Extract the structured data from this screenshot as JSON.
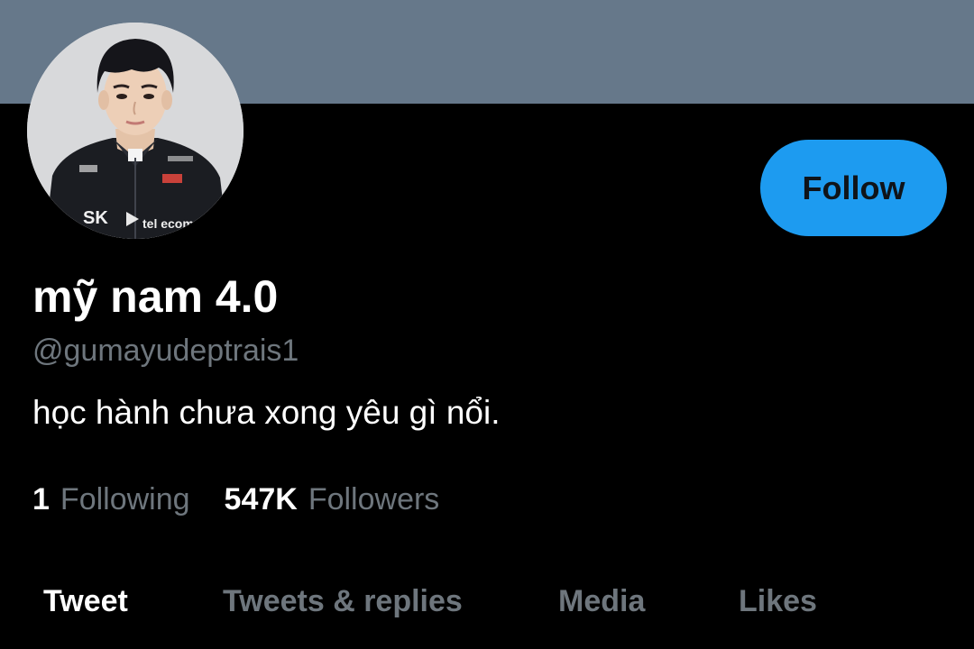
{
  "profile": {
    "display_name": "mỹ nam 4.0",
    "handle": "@gumayudeptrais1",
    "bio": "học hành chưa xong yêu gì nổi.",
    "follow_label": "Follow",
    "avatar_jacket_text": {
      "brand_left": "SK",
      "brand_right": "tel ecom"
    }
  },
  "stats": {
    "following_count": "1",
    "following_label": "Following",
    "followers_count": "547K",
    "followers_label": "Followers"
  },
  "tabs": [
    {
      "label": "Tweet",
      "active": true
    },
    {
      "label": "Tweets & replies",
      "active": false
    },
    {
      "label": "Media",
      "active": false
    },
    {
      "label": "Likes",
      "active": false
    }
  ],
  "colors": {
    "banner": "#66788a",
    "accent": "#1d9bf0",
    "background": "#000000",
    "muted_text": "#6e767d"
  }
}
